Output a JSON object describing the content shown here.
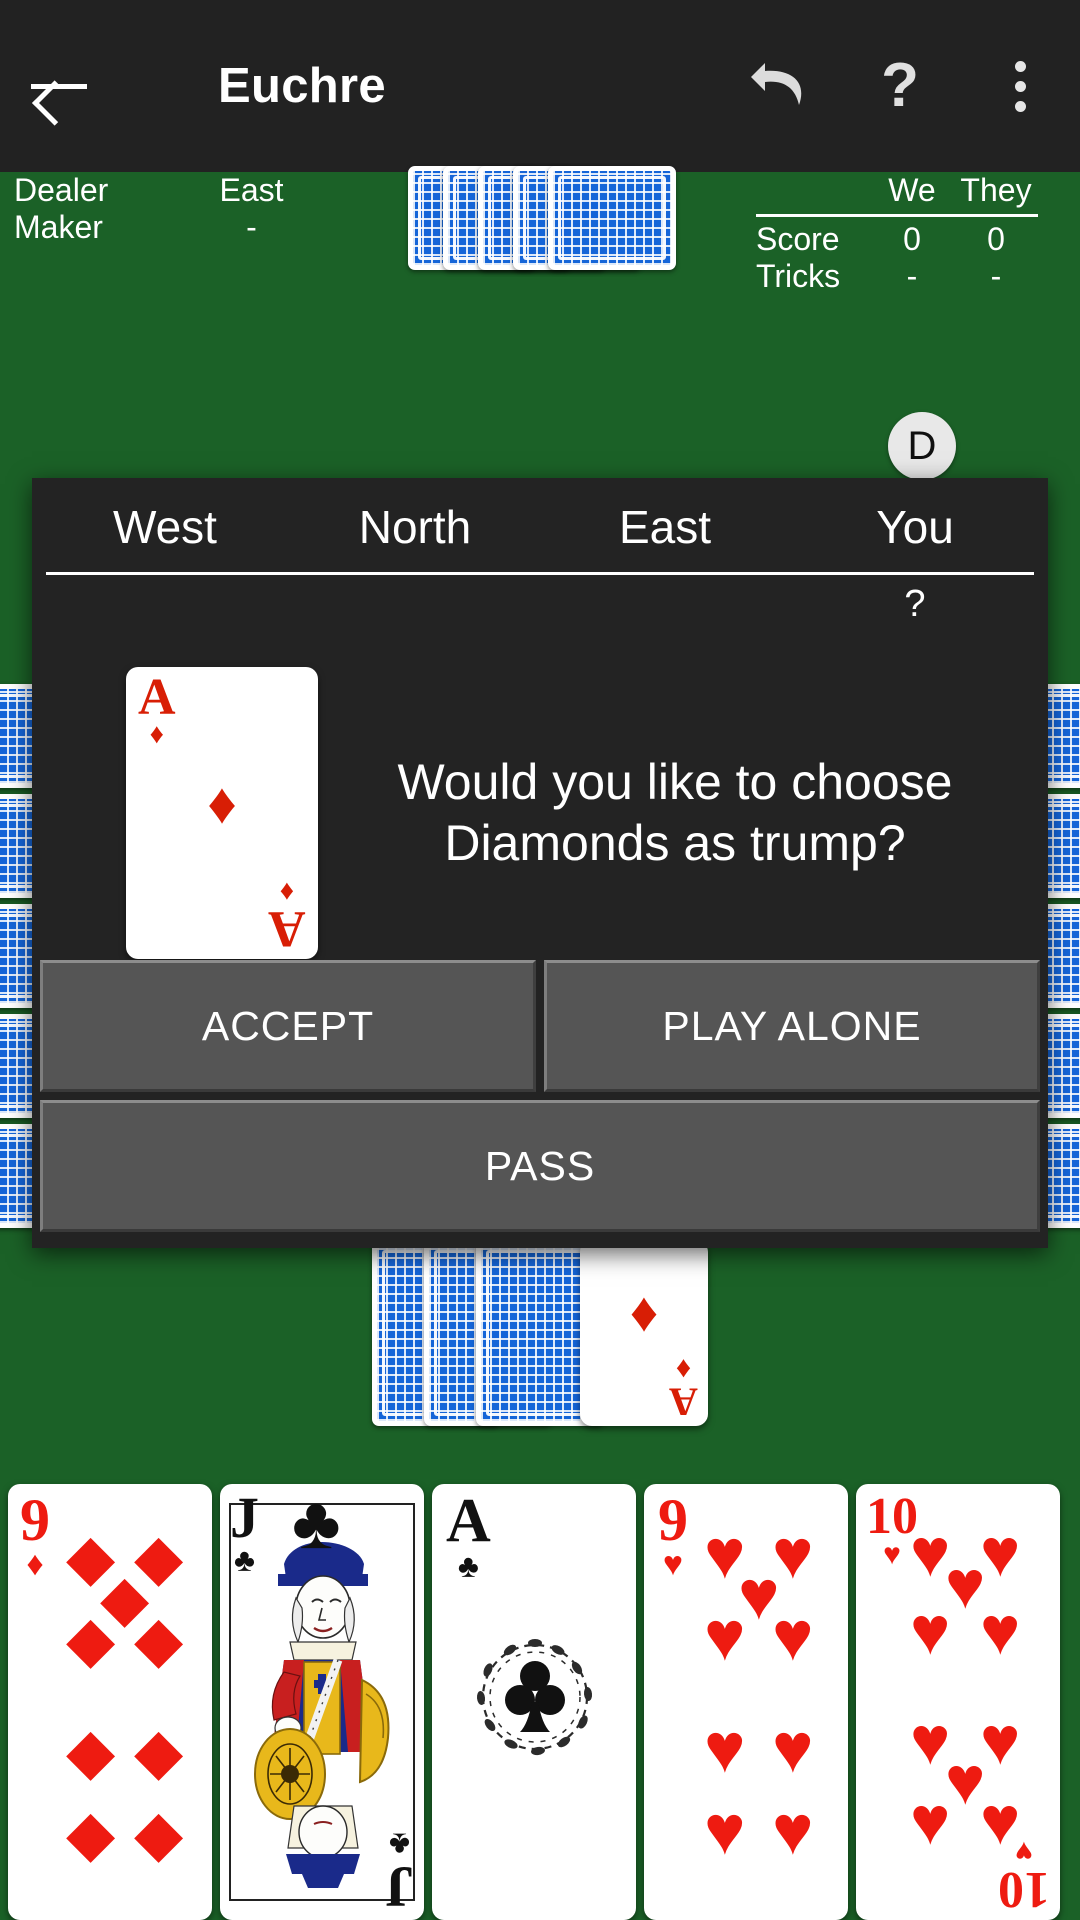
{
  "appbar": {
    "title": "Euchre",
    "back_icon": "back-arrow-icon",
    "undo_icon": "undo-icon",
    "help_icon": "question-mark-icon",
    "overflow_icon": "three-dot-menu-icon"
  },
  "table_info": {
    "dealer_label": "Dealer",
    "dealer_value": "East",
    "maker_label": "Maker",
    "maker_value": "-"
  },
  "scoreboard": {
    "col_we": "We",
    "col_they": "They",
    "rows": [
      {
        "label": "Score",
        "we": "0",
        "they": "0"
      },
      {
        "label": "Tricks",
        "we": "-",
        "they": "-"
      }
    ]
  },
  "dealer_badge": {
    "letter": "D"
  },
  "bidding": {
    "players": [
      "West",
      "North",
      "East",
      "You"
    ],
    "round_marks": [
      "",
      "",
      "",
      "?"
    ]
  },
  "dialog": {
    "upcard": {
      "rank": "A",
      "suit": "♦",
      "suit_name": "diamonds",
      "color": "#d81e05"
    },
    "question": "Would you like to choose Diamonds as trump?",
    "buttons": {
      "accept": "ACCEPT",
      "play_alone": "PLAY ALONE",
      "pass": "PASS"
    }
  },
  "table": {
    "north_hand_count": 5,
    "west_hand_count": 5,
    "east_hand_count": 5,
    "kitty_facedown_count": 3,
    "kitty_upcard": {
      "rank": "A",
      "suit": "♦",
      "color": "#d81e05"
    }
  },
  "player_hand": [
    {
      "rank": "9",
      "suit": "♦",
      "suit_name": "diamonds",
      "color": "#ee1b11",
      "pips": 9
    },
    {
      "rank": "J",
      "suit": "♣",
      "suit_name": "clubs",
      "color": "#111111",
      "court": true
    },
    {
      "rank": "A",
      "suit": "♣",
      "suit_name": "clubs",
      "color": "#111111",
      "pips": 1
    },
    {
      "rank": "9",
      "suit": "♥",
      "suit_name": "hearts",
      "color": "#ee1b11",
      "pips": 9
    },
    {
      "rank": "10",
      "suit": "♥",
      "suit_name": "hearts",
      "color": "#ee1b11",
      "pips": 10
    }
  ],
  "colors": {
    "felt_green": "#1b6127",
    "appbar_dark": "#222222",
    "dialog_dark": "#232323",
    "button_gray": "#555555",
    "card_back_blue": "#1565d8"
  }
}
